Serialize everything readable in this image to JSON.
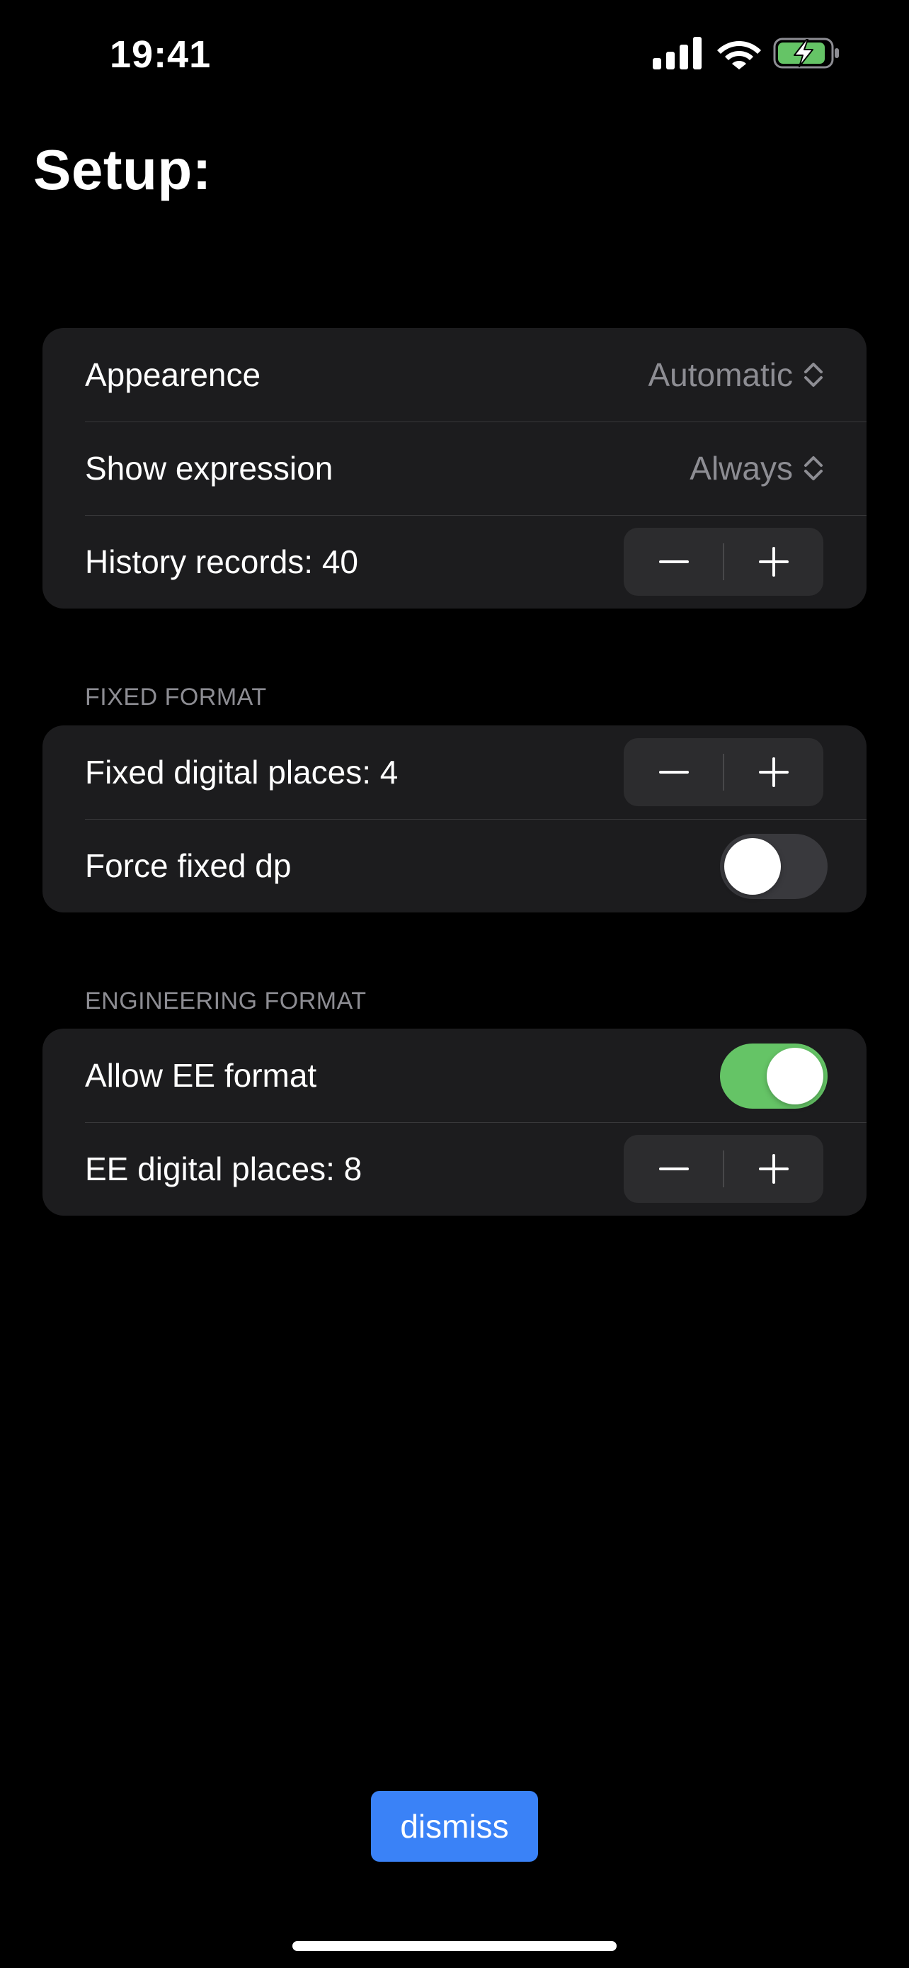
{
  "status_bar": {
    "time": "19:41",
    "signal_icon": "cellular-signal-icon",
    "wifi_icon": "wifi-icon",
    "battery_icon": "battery-charging-icon",
    "battery_color": "#65c466"
  },
  "page": {
    "title": "Setup:"
  },
  "general_group": {
    "appearance": {
      "label": "Appearence",
      "value": "Automatic",
      "icon": "chevron-up-down-icon"
    },
    "show_expression": {
      "label": "Show expression",
      "value": "Always",
      "icon": "chevron-up-down-icon"
    },
    "history_records": {
      "label": "History records: 40",
      "value": 40
    }
  },
  "fixed_format": {
    "header": "FIXED FORMAT",
    "fixed_places": {
      "label": "Fixed digital places: 4",
      "value": 4
    },
    "force_fixed_dp": {
      "label": "Force fixed dp",
      "on": false
    }
  },
  "engineering_format": {
    "header": "ENGINEERING FORMAT",
    "allow_ee": {
      "label": "Allow EE format",
      "on": true
    },
    "ee_places": {
      "label": "EE digital places: 8",
      "value": 8
    }
  },
  "dismiss_button": {
    "label": "dismiss",
    "color": "#3a82f7"
  },
  "colors": {
    "background": "#000000",
    "group_background": "#1c1c1e",
    "secondary_text": "#8d8d93",
    "toggle_on": "#65c466",
    "toggle_off": "#39393d"
  }
}
